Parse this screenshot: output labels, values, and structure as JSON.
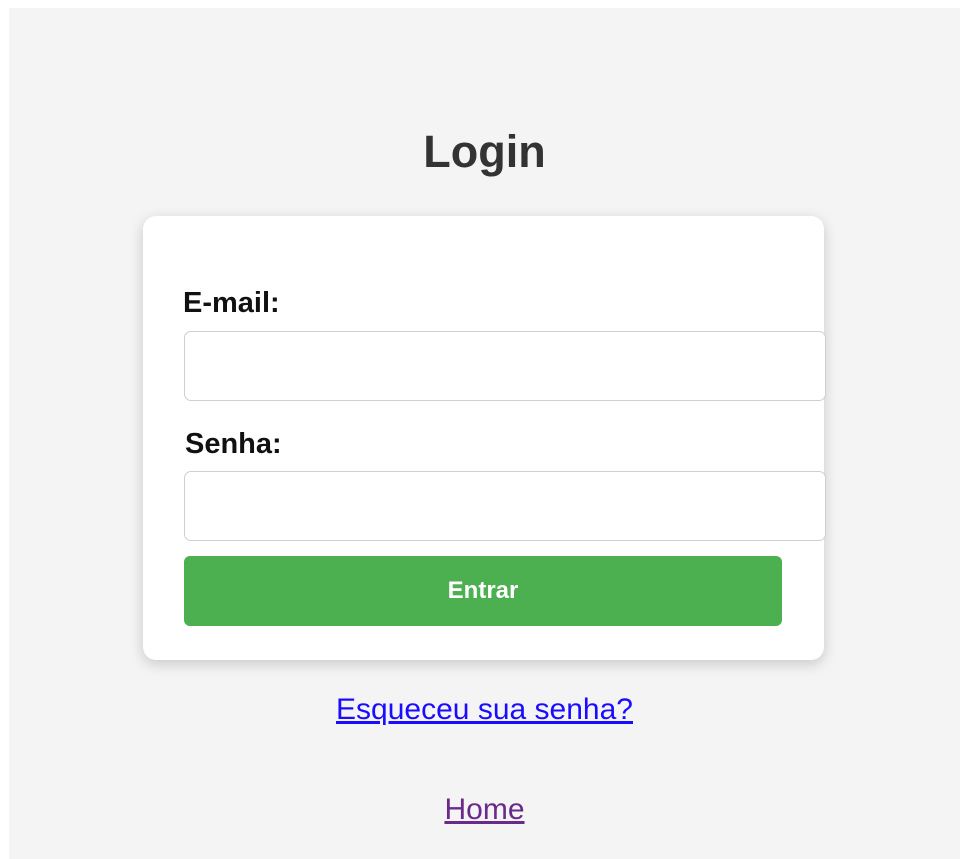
{
  "page": {
    "title": "Login"
  },
  "form": {
    "email_label": "E-mail:",
    "email_value": "",
    "password_label": "Senha:",
    "password_value": "",
    "submit_label": "Entrar"
  },
  "links": {
    "forgot_password": "Esqueceu sua senha?",
    "home": "Home"
  },
  "colors": {
    "background": "#f4f4f4",
    "card": "#ffffff",
    "submit_button": "#4caf50",
    "link": "#1a0dff",
    "visited_link": "#6a2a8a"
  }
}
